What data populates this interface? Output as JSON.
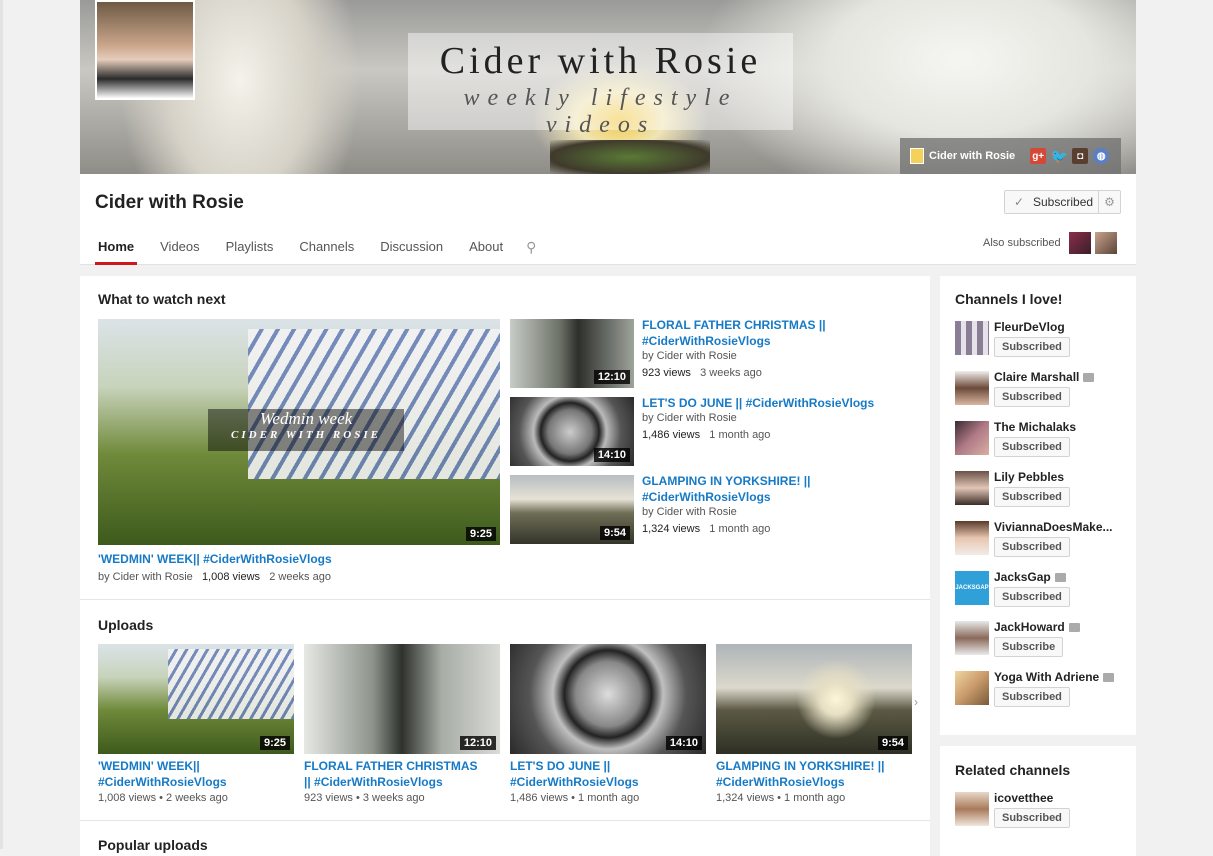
{
  "banner": {
    "title": "Cider with Rosie",
    "subtitle": "weekly lifestyle videos",
    "link_label": "Cider with Rosie"
  },
  "channel": {
    "name": "Cider with Rosie",
    "subscribe_label": "Subscribed",
    "also_subscribed": "Also subscribed"
  },
  "tabs": [
    "Home",
    "Videos",
    "Playlists",
    "Channels",
    "Discussion",
    "About"
  ],
  "what_next": {
    "title": "What to watch next",
    "featured": {
      "title": "'WEDMIN' WEEK|| #CiderWithRosieVlogs",
      "by": "by Cider with Rosie",
      "views": "1,008 views",
      "age": "2 weeks ago",
      "duration": "9:25",
      "overlay1": "Wedmin week",
      "overlay2": "CIDER WITH ROSIE"
    },
    "items": [
      {
        "title1": "FLORAL FATHER CHRISTMAS ||",
        "title2": "#CiderWithRosieVlogs",
        "by": "by Cider with Rosie",
        "views": "923 views",
        "age": "3 weeks ago",
        "duration": "12:10"
      },
      {
        "title1": "LET'S DO JUNE || #CiderWithRosieVlogs",
        "title2": "",
        "by": "by Cider with Rosie",
        "views": "1,486 views",
        "age": "1 month ago",
        "duration": "14:10"
      },
      {
        "title1": "GLAMPING IN YORKSHIRE! ||",
        "title2": "#CiderWithRosieVlogs",
        "by": "by Cider with Rosie",
        "views": "1,324 views",
        "age": "1 month ago",
        "duration": "9:54"
      }
    ]
  },
  "uploads": {
    "title": "Uploads",
    "items": [
      {
        "title1": "'WEDMIN' WEEK||",
        "title2": "#CiderWithRosieVlogs",
        "meta": "1,008 views • 2 weeks ago",
        "duration": "9:25"
      },
      {
        "title1": "FLORAL FATHER CHRISTMAS",
        "title2": "|| #CiderWithRosieVlogs",
        "meta": "923 views • 3 weeks ago",
        "duration": "12:10"
      },
      {
        "title1": "LET'S DO JUNE ||",
        "title2": "#CiderWithRosieVlogs",
        "meta": "1,486 views • 1 month ago",
        "duration": "14:10"
      },
      {
        "title1": "GLAMPING IN YORKSHIRE! ||",
        "title2": "#CiderWithRosieVlogs",
        "meta": "1,324 views • 1 month ago",
        "duration": "9:54"
      }
    ]
  },
  "popular": {
    "title": "Popular uploads"
  },
  "channels_love": {
    "title": "Channels I love!",
    "items": [
      {
        "name": "FleurDeVlog",
        "btn": "Subscribed"
      },
      {
        "name": "Claire Marshall",
        "btn": "Subscribed"
      },
      {
        "name": "The Michalaks",
        "btn": "Subscribed"
      },
      {
        "name": "Lily Pebbles",
        "btn": "Subscribed"
      },
      {
        "name": "ViviannaDoesMake...",
        "btn": "Subscribed"
      },
      {
        "name": "JacksGap",
        "btn": "Subscribed"
      },
      {
        "name": "JackHoward",
        "btn": "Subscribe"
      },
      {
        "name": "Yoga With Adriene",
        "btn": "Subscribed"
      }
    ]
  },
  "related": {
    "title": "Related channels",
    "items": [
      {
        "name": "icovetthee",
        "btn": "Subscribed"
      }
    ]
  }
}
